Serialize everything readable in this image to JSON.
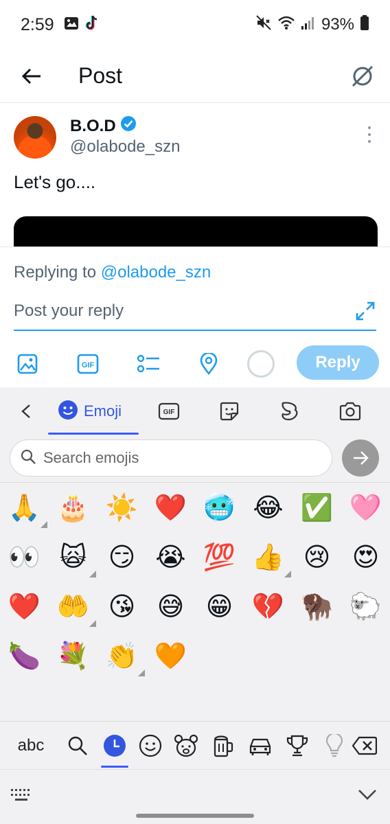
{
  "status_bar": {
    "time": "2:59",
    "battery": "93%"
  },
  "header": {
    "title": "Post"
  },
  "post": {
    "author_name": "B.O.D",
    "handle": "@olabode_szn",
    "text": "Let's go...."
  },
  "reply": {
    "replying_prefix": "Replying to",
    "replying_mention": "@olabode_szn",
    "placeholder": "Post your reply",
    "button_label": "Reply"
  },
  "keyboard": {
    "tabs": {
      "emoji_label": "Emoji"
    },
    "search_placeholder": "Search emojis",
    "emojis": [
      "🙏",
      "🎂",
      "☀️",
      "❤️",
      "🥶",
      "😂",
      "✅",
      "🩷",
      "👀",
      "🙀",
      "😏",
      "😭",
      "💯",
      "👍",
      "😢",
      "😍",
      "❤️",
      "🤲",
      "😘",
      "😅",
      "😁",
      "💔",
      "🦬",
      "🐑",
      "🍆",
      "💐",
      "👏",
      "🧡"
    ],
    "abc_label": "abc"
  }
}
